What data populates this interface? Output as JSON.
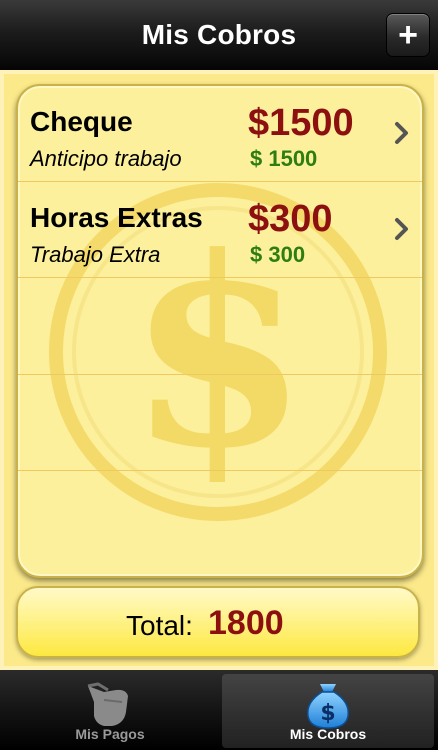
{
  "navbar": {
    "title": "Mis Cobros",
    "add_button_label": "+"
  },
  "list": {
    "items": [
      {
        "title": "Cheque",
        "subtitle": "Anticipo trabajo",
        "amount": "$1500",
        "amount_detail": "$ 1500"
      },
      {
        "title": "Horas Extras",
        "subtitle": "Trabajo Extra",
        "amount": "$300",
        "amount_detail": "$ 300"
      }
    ]
  },
  "total": {
    "label": "Total:",
    "value": "1800"
  },
  "tabbar": {
    "tabs": [
      {
        "label": "Mis Pagos",
        "icon": "hand-icon",
        "active": false
      },
      {
        "label": "Mis Cobros",
        "icon": "money-bag-icon",
        "active": true
      }
    ]
  },
  "colors": {
    "amount_red": "#8c1010",
    "amount_green": "#2d7d10",
    "card_yellow": "#fcf09c",
    "active_tab_text": "#ffffff",
    "inactive_tab_text": "#9a9a9a"
  }
}
